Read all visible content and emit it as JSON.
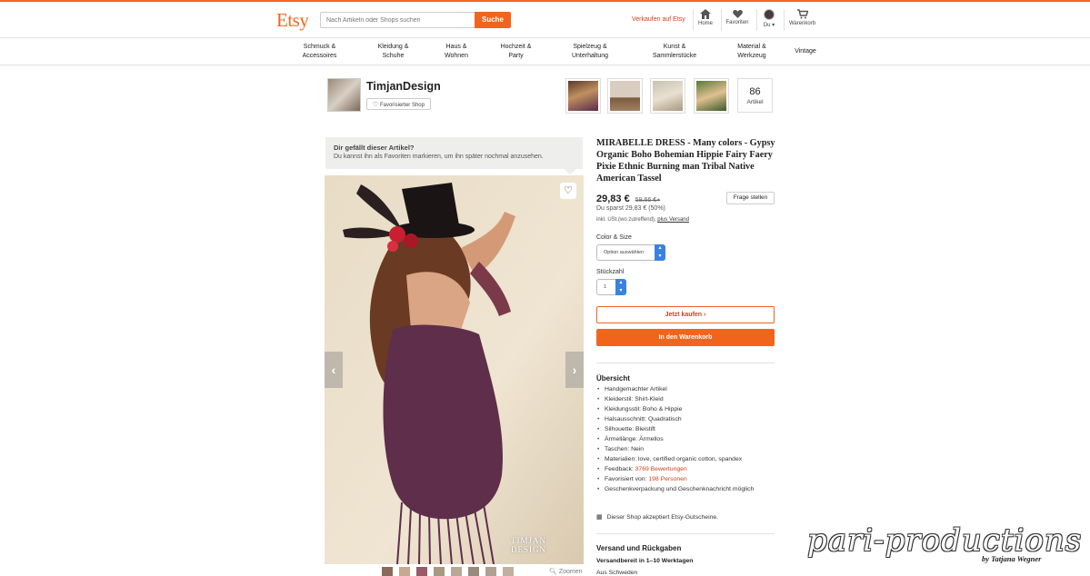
{
  "header": {
    "logo": "Etsy",
    "search_placeholder": "Nach Artikeln oder Shops suchen",
    "search_button": "Suche",
    "sell_link": "Verkaufen auf Etsy",
    "nav": [
      {
        "label": "Home",
        "icon": "home-icon"
      },
      {
        "label": "Favoriten",
        "icon": "heart-icon"
      },
      {
        "label": "Du ▾",
        "icon": "avatar"
      },
      {
        "label": "Warenkorb",
        "icon": "cart-icon"
      }
    ]
  },
  "categories": [
    {
      "l1": "Schmuck &",
      "l2": "Accessoires"
    },
    {
      "l1": "Kleidung &",
      "l2": "Schuhe"
    },
    {
      "l1": "Haus &",
      "l2": "Wohnen"
    },
    {
      "l1": "Hochzeit &",
      "l2": "Party"
    },
    {
      "l1": "Spielzeug &",
      "l2": "Unterhaltung"
    },
    {
      "l1": "Kunst &",
      "l2": "Sammlerstücke"
    },
    {
      "l1": "Material &",
      "l2": "Werkzeug"
    },
    {
      "l1": "Vintage",
      "l2": ""
    }
  ],
  "shop": {
    "name": "TimjanDesign",
    "favorite_label": "Favorisierter Shop",
    "item_count": "86",
    "item_count_label": "Artikel"
  },
  "like_banner": {
    "title": "Dir gefällt dieser Artikel?",
    "text": "Du kannst ihn als Favoriten markieren, um ihn später nochmal anzusehen."
  },
  "image": {
    "watermark": "TIMJAN DESIGN",
    "zoom_label": "Zoomen"
  },
  "product": {
    "title": "MIRABELLE DRESS - Many colors - Gypsy Organic Boho Bohemian Hippie Fairy Faery Pixie Ethnic Burning man Tribal Native American Tassel",
    "price": "29,83 €",
    "old_price": "59,66 €+",
    "ask_button": "Frage stellen",
    "savings": "Du sparst 29,83 € (50%)",
    "vat_text": "inkl. USt.(wo zutreffend),",
    "vat_link": "plus Versand",
    "color_label": "Color & Size",
    "color_select": "Option auswählen",
    "qty_label": "Stückzahl",
    "qty_value": "1",
    "buy_now": "Jetzt kaufen ›",
    "add_to_cart": "In den Warenkorb"
  },
  "overview": {
    "title": "Übersicht",
    "items": [
      {
        "text": "Handgemachter Artikel",
        "link": ""
      },
      {
        "text": "Kleiderstil: Shirt-Kleid",
        "link": ""
      },
      {
        "text": "Kleidungsstil: Boho & Hippie",
        "link": ""
      },
      {
        "text": "Halsausschnitt: Quadratisch",
        "link": ""
      },
      {
        "text": "Silhouette: Bleistift",
        "link": ""
      },
      {
        "text": "Ärmellänge: Ärmellos",
        "link": ""
      },
      {
        "text": "Taschen: Nein",
        "link": ""
      },
      {
        "text": "Materialien: love, certified organic cotton, spandex",
        "link": ""
      },
      {
        "text": "Feedback: ",
        "link": "3769 Bewertungen"
      },
      {
        "text": "Favorisiert von: ",
        "link": "198 Personen"
      },
      {
        "text": "Geschenkverpackung und Geschenknachricht möglich",
        "link": ""
      }
    ],
    "giftcard": "Dieser Shop akzeptiert Etsy-Gutscheine."
  },
  "shipping": {
    "title": "Versand und Rückgaben",
    "ready": "Versandbereit in 1–10 Werktagen",
    "from": "Aus Schweden"
  },
  "watermark": {
    "main": "pari-productions",
    "sub": "by Tatjana Wegner"
  },
  "colors": {
    "accent": "#f1641e",
    "link": "#d5401a"
  }
}
